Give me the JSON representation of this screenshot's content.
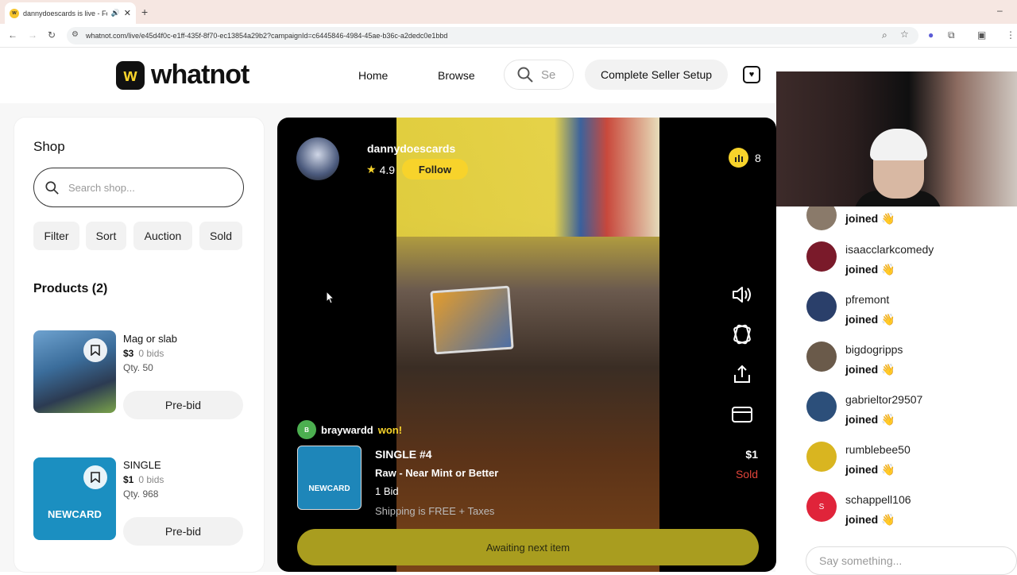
{
  "browser": {
    "tab_title": "dannydoescards is live - Fo",
    "url": "whatnot.com/live/e45d4f0c-e1ff-435f-8f70-ec13854a29b2?campaignId=c6445846-4984-45ae-b36c-a2dedc0e1bbd"
  },
  "header": {
    "logo": "whatnot",
    "nav": [
      "Home",
      "Browse"
    ],
    "search_placeholder": "Se",
    "cta": "Complete Seller Setup"
  },
  "shop": {
    "title": "Shop",
    "search_placeholder": "Search shop...",
    "filters": [
      "Filter",
      "Sort",
      "Auction",
      "Sold"
    ],
    "products_heading": "Products (2)",
    "products": [
      {
        "name": "Mag or slab",
        "price": "$3",
        "bids": "0 bids",
        "qty": "Qty. 50",
        "button": "Pre-bid"
      },
      {
        "name": "SINGLE",
        "price": "$1",
        "bids": "0 bids",
        "qty": "Qty. 968",
        "button": "Pre-bid"
      }
    ]
  },
  "stream": {
    "streamer": "dannydoescards",
    "rating": "4.9",
    "follow_label": "Follow",
    "viewers": "8",
    "winner_initial": "B",
    "winner": "braywardd",
    "won_label": "won!",
    "current": {
      "title": "SINGLE #4",
      "subtitle": "Raw - Near Mint or Better",
      "bids": "1 Bid",
      "shipping": "Shipping is FREE + Taxes",
      "price": "$1",
      "status": "Sold"
    },
    "awaiting": "Awaiting next item",
    "thumb_label": "NEWCARD"
  },
  "chat": {
    "messages": [
      {
        "user": "",
        "msg": "joined 👋",
        "color": "#8a7a6a"
      },
      {
        "user": "isaacclarkcomedy",
        "msg": "joined 👋",
        "color": "#7a1a2a"
      },
      {
        "user": "pfremont",
        "msg": "joined 👋",
        "color": "#2a3f6a"
      },
      {
        "user": "bigdogripps",
        "msg": "joined 👋",
        "color": "#6a5a4a"
      },
      {
        "user": "gabrieltor29507",
        "msg": "joined 👋",
        "color": "#2c4f7a"
      },
      {
        "user": "rumblebee50",
        "msg": "joined 👋",
        "color": "#d9b520"
      },
      {
        "user": "schappell106",
        "msg": "joined 👋",
        "color": "#e0243a",
        "initial": "S"
      }
    ],
    "input_placeholder": "Say something..."
  }
}
